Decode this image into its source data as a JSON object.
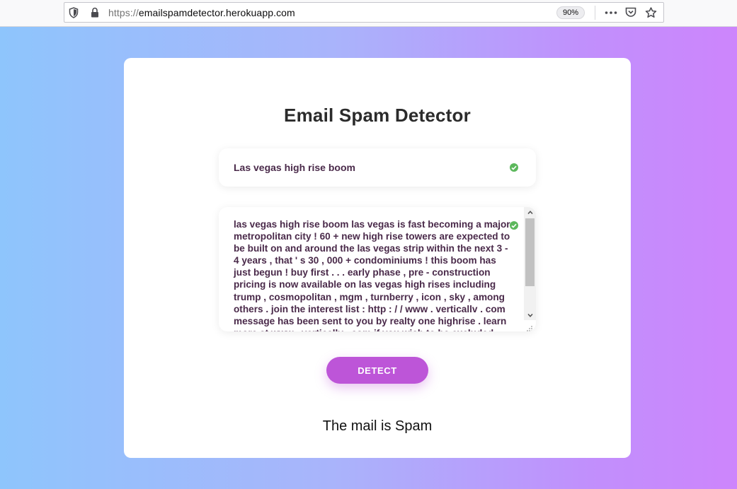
{
  "browser": {
    "url_protocol": "https://",
    "url_host": "emailspamdetector.herokuapp.com",
    "zoom": "90%",
    "icons": [
      "shield-icon",
      "lock-icon",
      "more-icon",
      "pocket-icon",
      "bookmark-star-icon"
    ]
  },
  "page": {
    "title": "Email Spam Detector",
    "subject": "Las vegas high rise boom",
    "body": "las vegas high rise boom  las vegas is fast becoming a major metropolitan city ! 60 +  new high rise towers are expected to be built on and around the las vegas strip  within the next 3 - 4 years , that ' s 30 , 000 + condominiums !  this boom has just begun ! buy first . . . early phase ,  pre - construction pricing is now available on las vegas high rises including  trump , cosmopolitan , mgm , turnberry , icon , sky , among others . join the interest list :  http : / / www . verticallv . com  message has been sent to you by realty one highrise . learn more at www . verticallv . com  if you wish to be excluded from future",
    "detect_label": "DETECT",
    "result": "The mail is Spam"
  },
  "colors": {
    "gradient_start": "#8ec5fc",
    "gradient_end": "#cd85fc",
    "button": "#bd55d8",
    "valid_check": "#5cb85c"
  }
}
